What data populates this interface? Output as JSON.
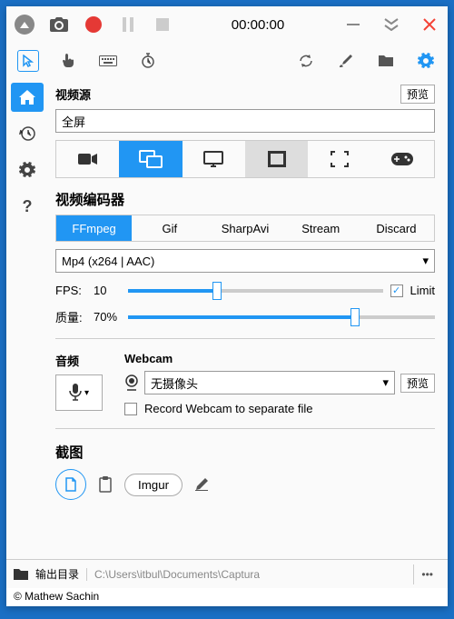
{
  "titlebar": {
    "timer": "00:00:00"
  },
  "source": {
    "heading": "视频源",
    "preview": "预览",
    "selected": "全屏"
  },
  "encoder": {
    "heading": "视频编码器",
    "tabs": [
      "FFmpeg",
      "Gif",
      "SharpAvi",
      "Stream",
      "Discard"
    ],
    "selected": "Mp4 (x264 | AAC)"
  },
  "fps": {
    "label": "FPS:",
    "value": "10",
    "limit_label": "Limit",
    "limit_checked": true
  },
  "quality": {
    "label": "质量:",
    "value": "70%"
  },
  "audio": {
    "heading": "音频"
  },
  "webcam": {
    "heading": "Webcam",
    "selected": "无摄像头",
    "preview": "预览",
    "record_separate": "Record Webcam to separate file"
  },
  "screenshot": {
    "heading": "截图",
    "imgur": "Imgur"
  },
  "footer": {
    "output_label": "输出目录",
    "path": "C:\\Users\\itbul\\Documents\\Captura"
  },
  "copyright": "© Mathew Sachin"
}
